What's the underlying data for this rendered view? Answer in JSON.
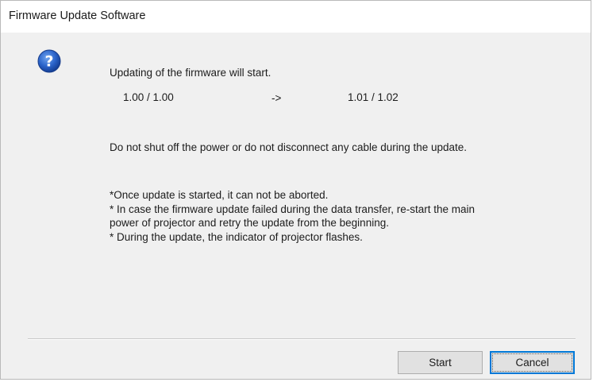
{
  "window": {
    "title": "Firmware Update Software"
  },
  "icon": {
    "name": "question-icon",
    "color": "#1f5fbf"
  },
  "message": {
    "heading": "Updating of the firmware will start.",
    "version_from": "1.00 / 1.00",
    "arrow": "->",
    "version_to": "1.01 / 1.02",
    "warning": "Do not shut off the power or do not disconnect any cable during the update."
  },
  "notes": [
    "*Once update is started, it can not be aborted.",
    "* In case the firmware update failed during the data transfer, re-start the main",
    "power of projector and retry the update from the beginning.",
    "* During the update, the indicator of projector flashes."
  ],
  "buttons": {
    "start_label": "Start",
    "cancel_label": "Cancel"
  }
}
